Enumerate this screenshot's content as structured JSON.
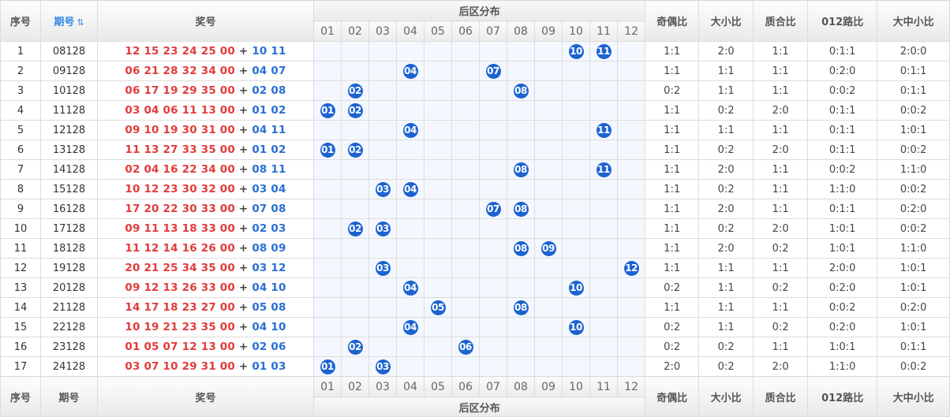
{
  "headers": {
    "idx": "序号",
    "period": "期号",
    "prize": "奖号",
    "backzone": "后区分布",
    "odd_even": "奇偶比",
    "big_small": "大小比",
    "prime_comp": "质合比",
    "road012": "012路比",
    "big_mid_small": "大中小比",
    "sort_icon": "sort-icon"
  },
  "columns": [
    "01",
    "02",
    "03",
    "04",
    "05",
    "06",
    "07",
    "08",
    "09",
    "10",
    "11",
    "12"
  ],
  "plus": "+",
  "rows": [
    {
      "idx": "1",
      "period": "08128",
      "front": "12 15 23 24 25 00",
      "back": "10 11",
      "balls": [
        "10",
        "11"
      ],
      "ratios": [
        "1:1",
        "2:0",
        "1:1",
        "0:1:1",
        "2:0:0"
      ]
    },
    {
      "idx": "2",
      "period": "09128",
      "front": "06 21 28 32 34 00",
      "back": "04 07",
      "balls": [
        "04",
        "07"
      ],
      "ratios": [
        "1:1",
        "1:1",
        "1:1",
        "0:2:0",
        "0:1:1"
      ]
    },
    {
      "idx": "3",
      "period": "10128",
      "front": "06 17 19 29 35 00",
      "back": "02 08",
      "balls": [
        "02",
        "08"
      ],
      "ratios": [
        "0:2",
        "1:1",
        "1:1",
        "0:0:2",
        "0:1:1"
      ]
    },
    {
      "idx": "4",
      "period": "11128",
      "front": "03 04 06 11 13 00",
      "back": "01 02",
      "balls": [
        "01",
        "02"
      ],
      "ratios": [
        "1:1",
        "0:2",
        "2:0",
        "0:1:1",
        "0:0:2"
      ]
    },
    {
      "idx": "5",
      "period": "12128",
      "front": "09 10 19 30 31 00",
      "back": "04 11",
      "balls": [
        "04",
        "11"
      ],
      "ratios": [
        "1:1",
        "1:1",
        "1:1",
        "0:1:1",
        "1:0:1"
      ]
    },
    {
      "idx": "6",
      "period": "13128",
      "front": "11 13 27 33 35 00",
      "back": "01 02",
      "balls": [
        "01",
        "02"
      ],
      "ratios": [
        "1:1",
        "0:2",
        "2:0",
        "0:1:1",
        "0:0:2"
      ]
    },
    {
      "idx": "7",
      "period": "14128",
      "front": "02 04 16 22 34 00",
      "back": "08 11",
      "balls": [
        "08",
        "11"
      ],
      "ratios": [
        "1:1",
        "2:0",
        "1:1",
        "0:0:2",
        "1:1:0"
      ]
    },
    {
      "idx": "8",
      "period": "15128",
      "front": "10 12 23 30 32 00",
      "back": "03 04",
      "balls": [
        "03",
        "04"
      ],
      "ratios": [
        "1:1",
        "0:2",
        "1:1",
        "1:1:0",
        "0:0:2"
      ]
    },
    {
      "idx": "9",
      "period": "16128",
      "front": "17 20 22 30 33 00",
      "back": "07 08",
      "balls": [
        "07",
        "08"
      ],
      "ratios": [
        "1:1",
        "2:0",
        "1:1",
        "0:1:1",
        "0:2:0"
      ]
    },
    {
      "idx": "10",
      "period": "17128",
      "front": "09 11 13 18 33 00",
      "back": "02 03",
      "balls": [
        "02",
        "03"
      ],
      "ratios": [
        "1:1",
        "0:2",
        "2:0",
        "1:0:1",
        "0:0:2"
      ]
    },
    {
      "idx": "11",
      "period": "18128",
      "front": "11 12 14 16 26 00",
      "back": "08 09",
      "balls": [
        "08",
        "09"
      ],
      "ratios": [
        "1:1",
        "2:0",
        "0:2",
        "1:0:1",
        "1:1:0"
      ]
    },
    {
      "idx": "12",
      "period": "19128",
      "front": "20 21 25 34 35 00",
      "back": "03 12",
      "balls": [
        "03",
        "12"
      ],
      "ratios": [
        "1:1",
        "1:1",
        "1:1",
        "2:0:0",
        "1:0:1"
      ]
    },
    {
      "idx": "13",
      "period": "20128",
      "front": "09 12 13 26 33 00",
      "back": "04 10",
      "balls": [
        "04",
        "10"
      ],
      "ratios": [
        "0:2",
        "1:1",
        "0:2",
        "0:2:0",
        "1:0:1"
      ]
    },
    {
      "idx": "14",
      "period": "21128",
      "front": "14 17 18 23 27 00",
      "back": "05 08",
      "balls": [
        "05",
        "08"
      ],
      "ratios": [
        "1:1",
        "1:1",
        "1:1",
        "0:0:2",
        "0:2:0"
      ]
    },
    {
      "idx": "15",
      "period": "22128",
      "front": "10 19 21 23 35 00",
      "back": "04 10",
      "balls": [
        "04",
        "10"
      ],
      "ratios": [
        "0:2",
        "1:1",
        "0:2",
        "0:2:0",
        "1:0:1"
      ]
    },
    {
      "idx": "16",
      "period": "23128",
      "front": "01 05 07 12 13 00",
      "back": "02 06",
      "balls": [
        "02",
        "06"
      ],
      "ratios": [
        "0:2",
        "0:2",
        "1:1",
        "1:0:1",
        "0:1:1"
      ]
    },
    {
      "idx": "17",
      "period": "24128",
      "front": "03 07 10 29 31 00",
      "back": "01 03",
      "balls": [
        "01",
        "03"
      ],
      "ratios": [
        "2:0",
        "0:2",
        "2:0",
        "1:1:0",
        "0:0:2"
      ]
    }
  ],
  "colors": {
    "front": "#e23b3b",
    "back": "#2a6fd6",
    "ball": "#1c63d1",
    "sort": "#2e8ae6"
  }
}
